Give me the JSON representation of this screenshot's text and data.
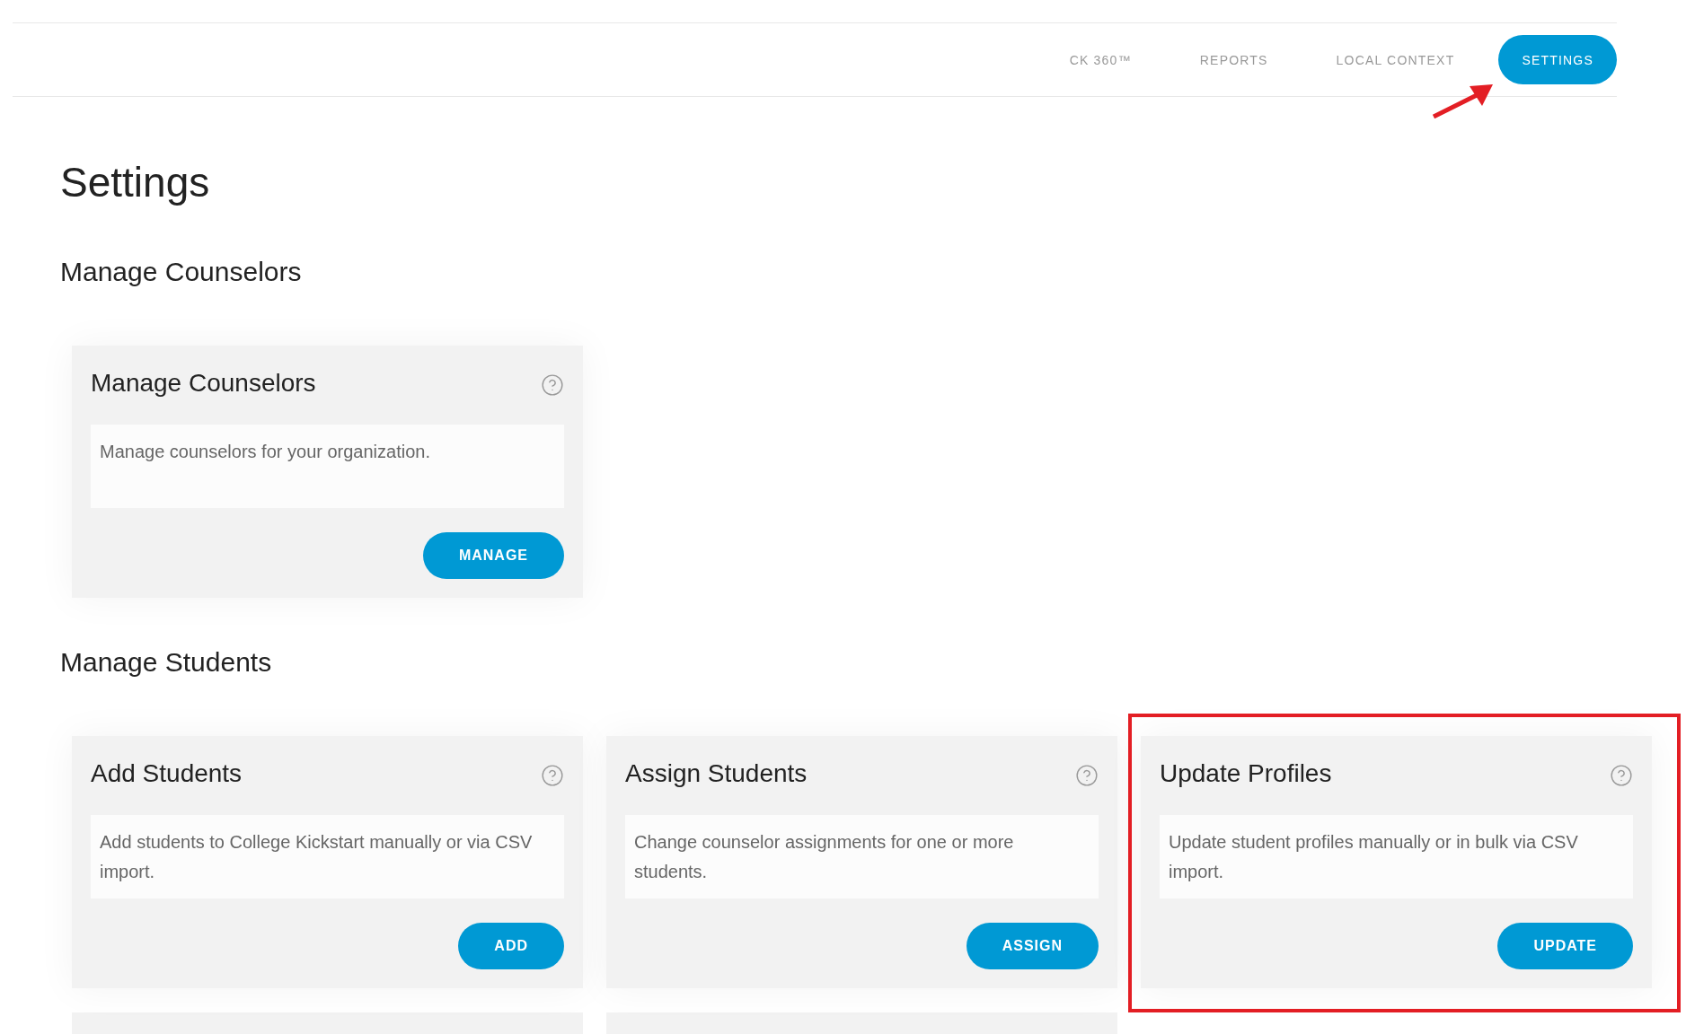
{
  "nav": {
    "items": [
      {
        "label": "CK 360™",
        "selected": false,
        "pointed_at": false
      },
      {
        "label": "REPORTS",
        "selected": false,
        "pointed_at": false
      },
      {
        "label": "LOCAL CONTEXT",
        "selected": false,
        "pointed_at": false
      },
      {
        "label": "SETTINGS",
        "selected": true,
        "pointed_at": true
      }
    ]
  },
  "page_title": "Settings",
  "sections": [
    {
      "heading": "Manage Counselors",
      "cards": [
        {
          "title": "Manage Counselors",
          "description": "Manage counselors for your organization.",
          "button": "MANAGE",
          "highlighted": false
        }
      ]
    },
    {
      "heading": "Manage Students",
      "cards": [
        {
          "title": "Add Students",
          "description": "Add students to College Kickstart manually or via CSV import.",
          "button": "ADD",
          "highlighted": false
        },
        {
          "title": "Assign Students",
          "description": "Change counselor assignments for one or more students.",
          "button": "ASSIGN",
          "highlighted": false
        },
        {
          "title": "Update Profiles",
          "description": "Update student profiles manually or in bulk via CSV import.",
          "button": "UPDATE",
          "highlighted": true
        }
      ],
      "cut_off_cards": [
        {
          "kind": "card"
        },
        {
          "kind": "card"
        }
      ]
    }
  ]
}
